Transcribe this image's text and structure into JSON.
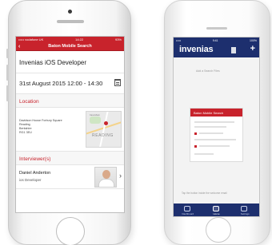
{
  "left_phone": {
    "status_bar": {
      "carrier": "••••• vodafone UK",
      "time": "14:22",
      "battery": "93%"
    },
    "nav": {
      "back_icon": "chevron-left-icon",
      "title": "Baton Mobile Search"
    },
    "job_title": "Invenias iOS Developer",
    "date_time": "31st August 2015 12:00 - 14:30",
    "calendar_icon": "calendar-icon",
    "location_heading": "Location",
    "address_lines": [
      "Davidson House Forbury Square",
      "Reading",
      "Berkshire",
      "RG1 3EU"
    ],
    "map": {
      "label": "READING",
      "label_small": "Caversham"
    },
    "interviewers_heading": "Interviewer(s)",
    "interviewer": {
      "name": "Daniel Anderton",
      "role": "ios Developer"
    },
    "row_chevron": "chevron-right-icon"
  },
  "right_phone": {
    "status_bar": {
      "signal": "•••••",
      "time": "9:41",
      "battery": "100%"
    },
    "logo_text": "invenias",
    "plus_icon": "+",
    "hint_text": "Add a Search Files",
    "card_title": "Baton Mobile Search",
    "footer_text": "Tap the button inside the welcome email",
    "tabs": [
      {
        "label": "Dashboard",
        "icon": "dashboard-icon"
      },
      {
        "label": "Home",
        "icon": "home-icon"
      },
      {
        "label": "Settings",
        "icon": "settings-icon"
      }
    ],
    "active_tab": 1,
    "colors": {
      "header": "#1d2f6e",
      "accent": "#c8232c"
    }
  }
}
